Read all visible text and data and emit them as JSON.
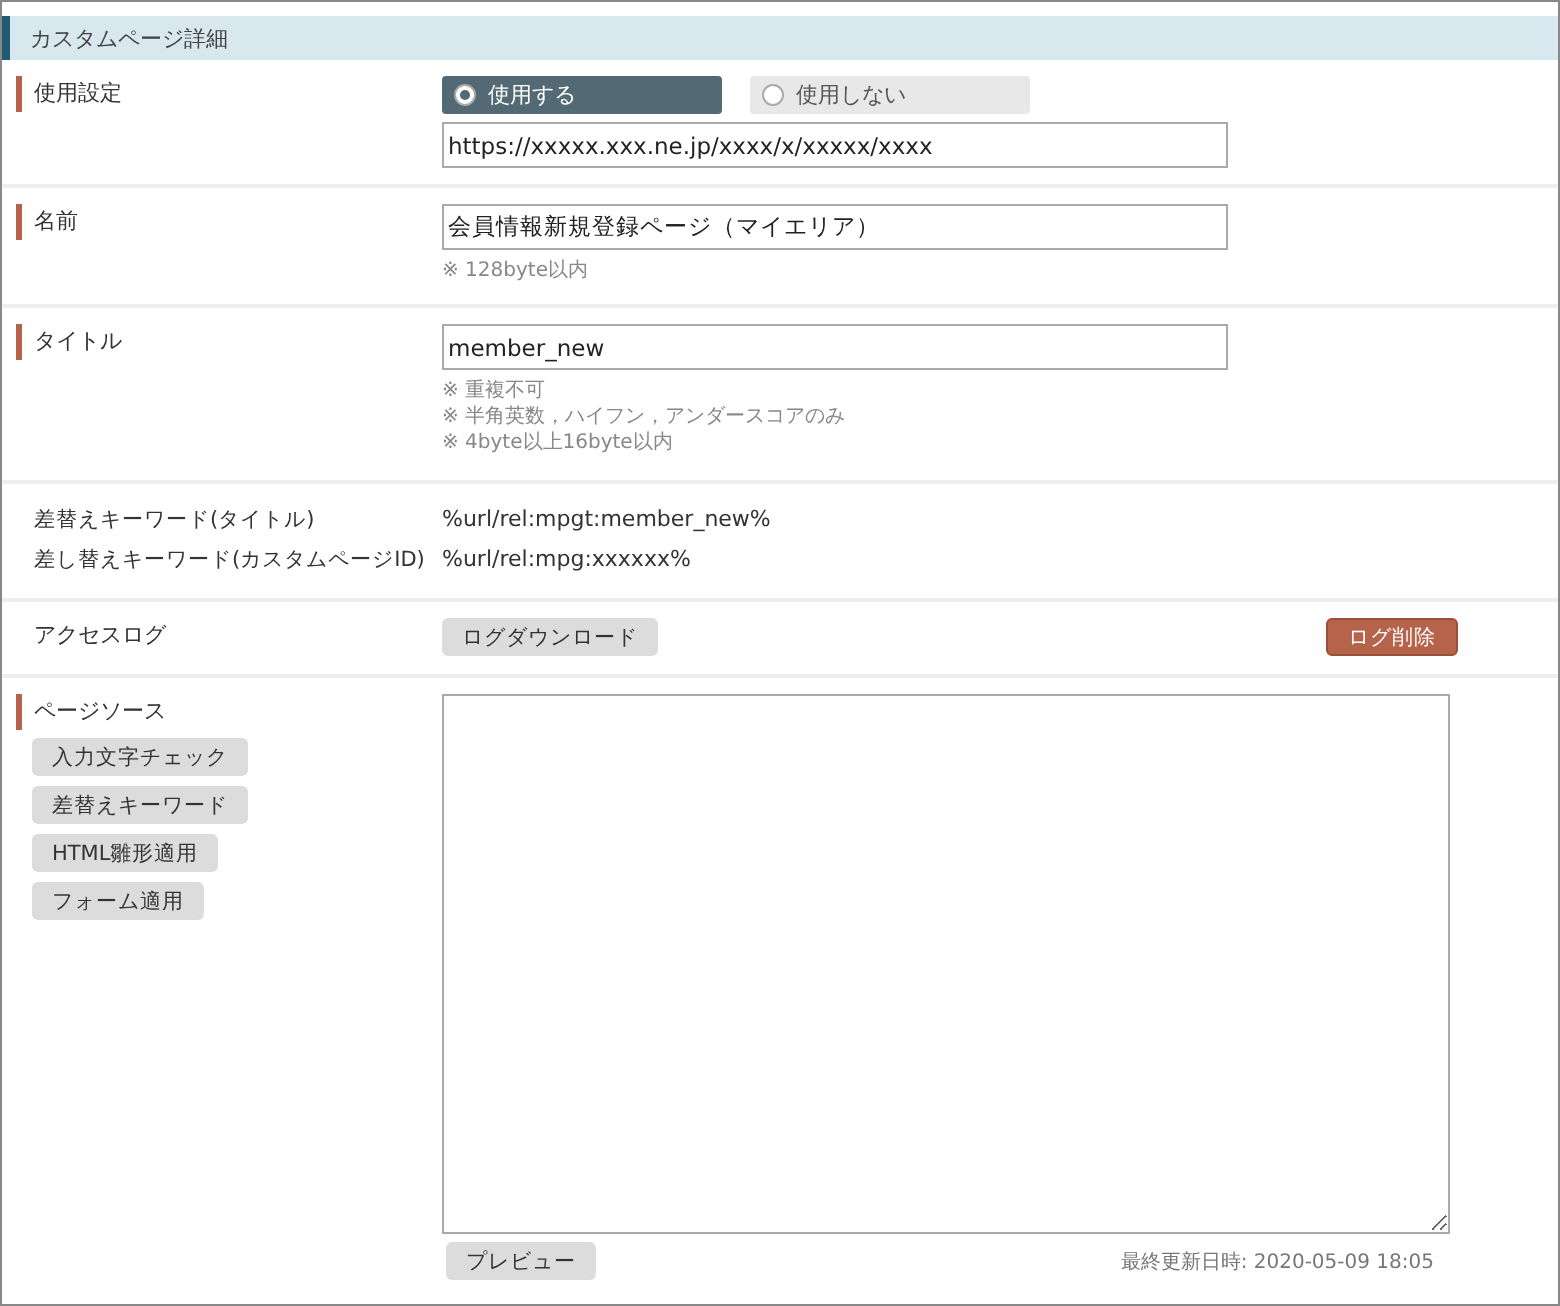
{
  "panel": {
    "title": "カスタムページ詳細"
  },
  "usage": {
    "label": "使用設定",
    "marked": true,
    "options": [
      {
        "label": "使用する",
        "selected": true
      },
      {
        "label": "使用しない",
        "selected": false
      }
    ],
    "url": "https://xxxxx.xxx.ne.jp/xxxx/x/xxxxx/xxxx"
  },
  "name": {
    "label": "名前",
    "marked": true,
    "value": "会員情報新規登録ページ（マイエリア）",
    "notes": [
      "※ 128byte以内"
    ]
  },
  "title_field": {
    "label": "タイトル",
    "marked": true,
    "value": "member_new",
    "notes": [
      "※ 重複不可",
      "※ 半角英数，ハイフン，アンダースコアのみ",
      "※ 4byte以上16byte以内"
    ]
  },
  "keywords": [
    {
      "label": "差替えキーワード(タイトル)",
      "value": "%url/rel:mpgt:member_new%"
    },
    {
      "label": "差し替えキーワード(カスタムページID)",
      "value": "%url/rel:mpg:xxxxxx%"
    }
  ],
  "access_log": {
    "label": "アクセスログ",
    "marked": false,
    "download": "ログダウンロード",
    "delete": "ログ削除"
  },
  "page_source": {
    "label": "ページソース",
    "marked": true,
    "tools": [
      "入力文字チェック",
      "差替えキーワード",
      "HTML雛形適用",
      "フォーム適用"
    ],
    "preview": "プレビュー",
    "last_updated": "最終更新日時: 2020-05-09 18:05"
  }
}
